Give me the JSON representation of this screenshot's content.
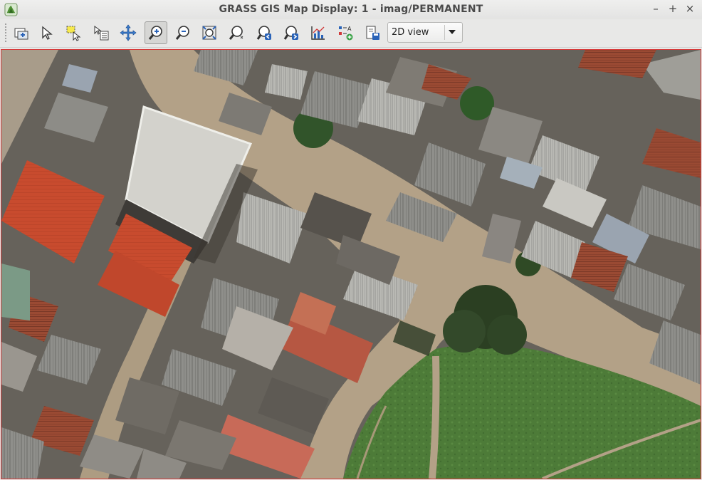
{
  "window": {
    "title": "GRASS GIS Map Display: 1 - imag/PERMANENT",
    "controls": {
      "minimize": "–",
      "maximize": "+",
      "close": "×"
    }
  },
  "toolbar": {
    "tools": [
      "add-map-layers-icon",
      "pointer-icon",
      "select-region-icon",
      "query-icon",
      "pan-icon",
      "zoom-in-icon",
      "zoom-out-icon",
      "zoom-extent-icon",
      "zoom-options-icon",
      "zoom-back-icon",
      "zoom-forward-icon",
      "analyze-icon",
      "decorations-icon",
      "save-display-icon"
    ],
    "active_tool": "zoom-in-icon",
    "view_mode": {
      "selected": "2D view"
    }
  },
  "colors": {
    "canvas_border": "#d63a3a",
    "roof_red": "#c5492e",
    "grass": "#4c7a38",
    "road": "#b3a187"
  }
}
